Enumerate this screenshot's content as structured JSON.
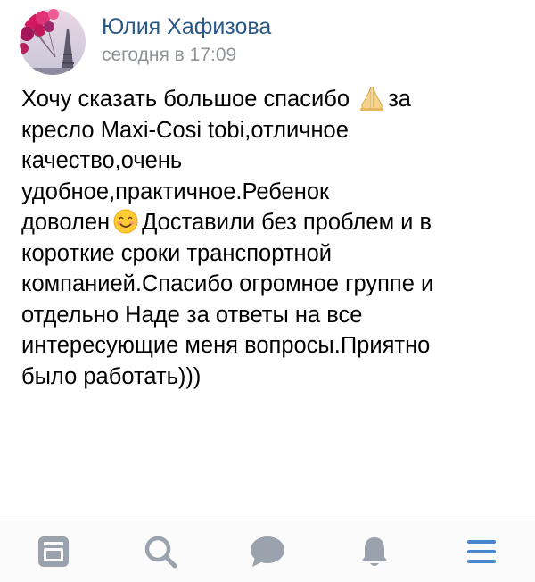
{
  "post": {
    "author_name": "Юлия Хафизова",
    "timestamp": "сегодня в 17:09",
    "avatar": "eiffel-tower-balloons-avatar",
    "text_line_1": "Хочу сказать большое спасибо ",
    "text_line_1_emoji": "folded-hands-emoji",
    "text_line_1_end": "за",
    "text_line_2": "кресло Maxi-Cosi tobi,отличное",
    "text_line_3": "качество,очень",
    "text_line_4": "удобное,практичное.Ребенок",
    "text_line_5_start": "доволен",
    "text_line_5_emoji": "smiling-face-emoji",
    "text_line_5_end": "Доставили без проблем и в",
    "text_line_6": "короткие сроки транспортной",
    "text_line_7": "компанией.Спасибо огромное группе и",
    "text_line_8": "отдельно Наде за ответы на все",
    "text_line_9": "интересующие меня вопросы.Приятно",
    "text_line_10": "было работать)))"
  },
  "tabbar": {
    "items": [
      {
        "icon": "news-feed-icon",
        "active": false
      },
      {
        "icon": "search-icon",
        "active": false
      },
      {
        "icon": "messages-icon",
        "active": false
      },
      {
        "icon": "notifications-bell-icon",
        "active": false
      },
      {
        "icon": "menu-icon",
        "active": true
      }
    ]
  },
  "colors": {
    "author_name": "#2a5885",
    "timestamp": "#909499",
    "tab_icon_inactive": "#99a2ad",
    "tab_icon_active": "#4986cc"
  }
}
